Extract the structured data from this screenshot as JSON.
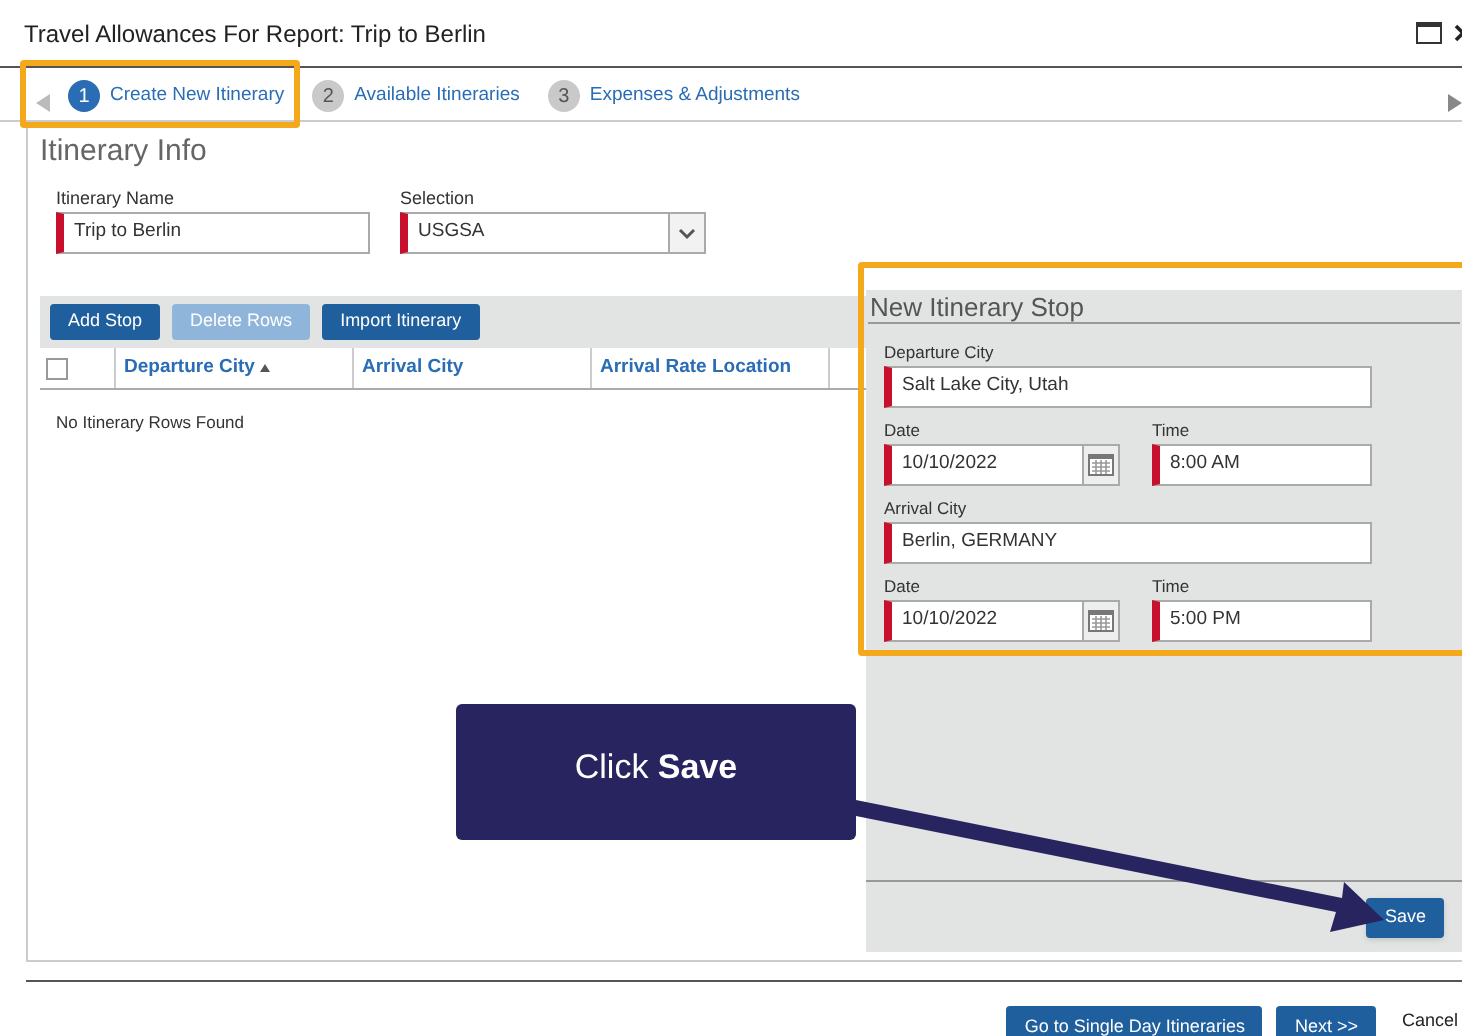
{
  "window": {
    "title": "Travel Allowances For Report: Trip to Berlin"
  },
  "steps": [
    {
      "number": "1",
      "label": "Create New Itinerary",
      "selected": true
    },
    {
      "number": "2",
      "label": "Available Itineraries",
      "selected": false
    },
    {
      "number": "3",
      "label": "Expenses & Adjustments",
      "selected": false
    }
  ],
  "itinerary_info": {
    "heading": "Itinerary Info",
    "fields": [
      {
        "label": "Itinerary Name",
        "value": "Trip to Berlin",
        "kind": "text",
        "required": true
      },
      {
        "label": "Selection",
        "value": "USGSA",
        "kind": "select",
        "required": true
      }
    ]
  },
  "toolbar": [
    {
      "label": "Add Stop",
      "disabled": false
    },
    {
      "label": "Delete Rows",
      "disabled": true
    },
    {
      "label": "Import Itinerary",
      "disabled": false
    }
  ],
  "table": {
    "select_all_checked": false,
    "columns": [
      {
        "label": "Departure City",
        "sorted": true
      },
      {
        "label": "Arrival City",
        "sorted": false
      },
      {
        "label": "Arrival Rate Location",
        "sorted": false
      }
    ],
    "empty_message": "No Itinerary Rows Found"
  },
  "stop_panel": {
    "heading": "New Itinerary Stop",
    "rows": [
      [
        {
          "label": "Departure City",
          "value": "Salt Lake City, Utah",
          "kind": "text",
          "required": true
        }
      ],
      [
        {
          "label": "Date",
          "value": "10/10/2022",
          "kind": "date",
          "required": true
        },
        {
          "label": "Time",
          "value": "8:00 AM",
          "kind": "time",
          "required": true
        }
      ],
      [
        {
          "label": "Arrival City",
          "value": "Berlin, GERMANY",
          "kind": "text",
          "required": true
        }
      ],
      [
        {
          "label": "Date",
          "value": "10/10/2022",
          "kind": "date",
          "required": true
        },
        {
          "label": "Time",
          "value": "5:00 PM",
          "kind": "time",
          "required": true
        }
      ]
    ],
    "save": "Save"
  },
  "callout": {
    "text": "Click **Save**"
  },
  "footer_buttons": [
    {
      "label": "Go to Single Day Itineraries",
      "kind": "primary"
    },
    {
      "label": "Next >>",
      "kind": "primary"
    },
    {
      "label": "Cancel",
      "kind": "link"
    }
  ]
}
